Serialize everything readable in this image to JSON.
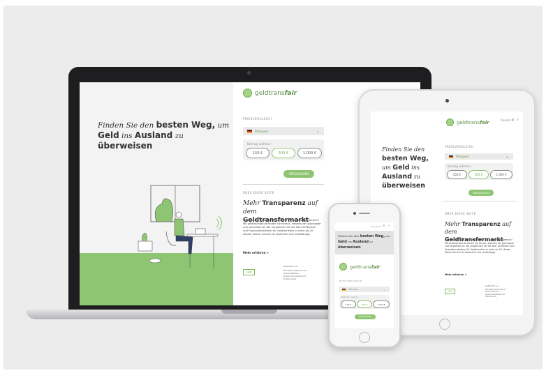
{
  "brand": {
    "logo_prefix": "geldtrans",
    "logo_suffix": "fair",
    "accent_color": "#8dc572"
  },
  "hero": {
    "w1": "Finden Sie den",
    "w2": "besten Weg,",
    "w3": "um",
    "w4": "Geld",
    "w5": "ins",
    "w6": "Ausland",
    "w7": "zu",
    "w8": "überweisen"
  },
  "header": {
    "lang": "Deutsch",
    "icons": [
      "menu-icon",
      "search-icon"
    ]
  },
  "form": {
    "section_label": "PREISVERGLEICH",
    "country": "Äthiopien",
    "amount_label": "Betrag wählen:",
    "amounts": [
      "150 €",
      "500 €",
      "1.000 €"
    ],
    "selected_amount": "500 €",
    "cta": "VERGLEICHEN"
  },
  "about": {
    "label": "ÜBER DIESE SEITE",
    "t1": "Mehr",
    "t2": "Transparenz",
    "t3": "auf dem",
    "t4": "Geldtransfermarkt",
    "text": "Sie möchten Geld von Deutschland ins Ausland überweisen? Mit geldtransfair.de finden Sie heraus, welches der günstigste und schnellste ist. Wir vergleichen für Sie über 20 Banken und Finanzdienstleister für Geldtransfers in mehr als 20 Länder. Dieser Service ist kostenfrei und unabhängig.",
    "more": "Mehr erfahren  >"
  },
  "footer": {
    "cfm_logo": "CFM",
    "bmz_label": "Gefördert von",
    "bmz_text": "Bundesministerium für wirtschaftliche Zusammenarbeit und Entwicklung"
  }
}
